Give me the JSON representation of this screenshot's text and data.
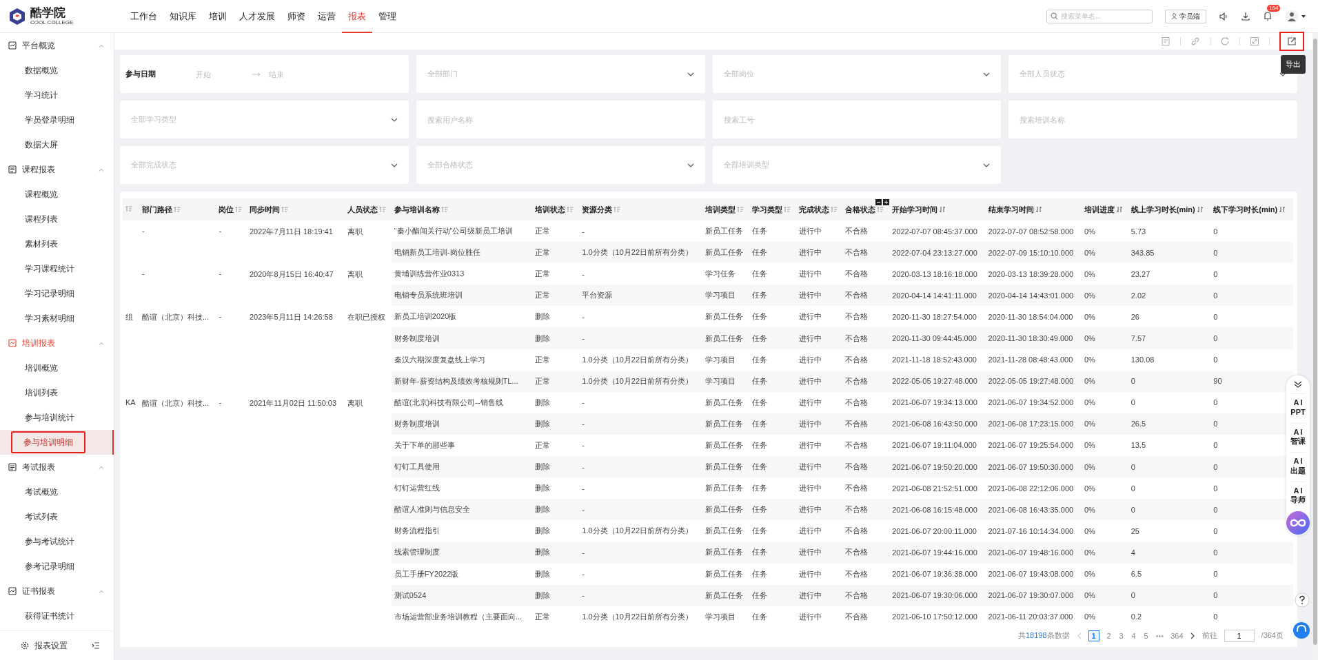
{
  "header": {
    "logo_name": "酷学院",
    "logo_sub": "COOL COLLEGE",
    "nav": [
      {
        "label": "工作台",
        "selected": false
      },
      {
        "label": "知识库",
        "selected": false
      },
      {
        "label": "培训",
        "selected": false
      },
      {
        "label": "人才发展",
        "selected": false
      },
      {
        "label": "师资",
        "selected": false
      },
      {
        "label": "运营",
        "selected": false
      },
      {
        "label": "报表",
        "selected": true
      },
      {
        "label": "管理",
        "selected": false
      }
    ],
    "search": {
      "placeholder": "搜索菜单名..."
    },
    "student_button": "学员端",
    "notification_count": "164"
  },
  "sidebar": {
    "groups": [
      {
        "title": "平台概览",
        "selected": false,
        "expanded": true,
        "items": [
          {
            "label": "数据概览",
            "selected": false
          },
          {
            "label": "学习统计",
            "selected": false
          },
          {
            "label": "学员登录明细",
            "selected": false
          },
          {
            "label": "数据大屏",
            "selected": false
          }
        ]
      },
      {
        "title": "课程报表",
        "selected": false,
        "expanded": true,
        "items": [
          {
            "label": "课程概览",
            "selected": false
          },
          {
            "label": "课程列表",
            "selected": false
          },
          {
            "label": "素材列表",
            "selected": false
          },
          {
            "label": "学习课程统计",
            "selected": false
          },
          {
            "label": "学习记录明细",
            "selected": false
          },
          {
            "label": "学习素材明细",
            "selected": false
          }
        ]
      },
      {
        "title": "培训报表",
        "selected": true,
        "expanded": true,
        "items": [
          {
            "label": "培训概览",
            "selected": false
          },
          {
            "label": "培训列表",
            "selected": false
          },
          {
            "label": "参与培训统计",
            "selected": false
          },
          {
            "label": "参与培训明细",
            "selected": true
          }
        ]
      },
      {
        "title": "考试报表",
        "selected": false,
        "expanded": true,
        "items": [
          {
            "label": "考试概览",
            "selected": false
          },
          {
            "label": "考试列表",
            "selected": false
          },
          {
            "label": "参与考试统计",
            "selected": false
          },
          {
            "label": "参考记录明细",
            "selected": false
          }
        ]
      },
      {
        "title": "证书报表",
        "selected": false,
        "expanded": true,
        "items": [
          {
            "label": "获得证书统计",
            "selected": false
          }
        ]
      }
    ],
    "settings": "报表设置"
  },
  "toolbar": {
    "export_tooltip": "导出"
  },
  "filters": [
    {
      "kind": "daterange",
      "label": "参与日期",
      "start_placeholder": "开始",
      "end_placeholder": "结束"
    },
    {
      "kind": "select",
      "placeholder": "全部部门"
    },
    {
      "kind": "select",
      "placeholder": "全部岗位"
    },
    {
      "kind": "select",
      "placeholder": "全部人员状态"
    },
    {
      "kind": "select",
      "placeholder": "全部学习类型"
    },
    {
      "kind": "input",
      "placeholder": "搜索用户名称"
    },
    {
      "kind": "input",
      "placeholder": "搜索工号"
    },
    {
      "kind": "input",
      "placeholder": "搜索培训名称"
    },
    {
      "kind": "select",
      "placeholder": "全部完成状态"
    },
    {
      "kind": "select",
      "placeholder": "全部合格状态"
    },
    {
      "kind": "select",
      "placeholder": "全部培训类型"
    }
  ],
  "table": {
    "columns": [
      {
        "kind": "list"
      },
      {
        "label": "部门路径",
        "kind": "list"
      },
      {
        "label": "岗位",
        "kind": "list"
      },
      {
        "label": "同步时间",
        "kind": "list"
      },
      {
        "label": "人员状态",
        "kind": "list"
      },
      {
        "label": "参与培训名称",
        "kind": "list"
      },
      {
        "label": "培训状态",
        "kind": "list"
      },
      {
        "label": "资源分类",
        "kind": "list"
      },
      {
        "label": "培训类型",
        "kind": "list"
      },
      {
        "label": "学习类型",
        "kind": "list"
      },
      {
        "label": "完成状态",
        "kind": "list"
      },
      {
        "label": "合格状态",
        "kind": "list",
        "expand_controls": true
      },
      {
        "label": "开始学习时间",
        "kind": "updown"
      },
      {
        "label": "结束学习时间",
        "kind": "updown"
      },
      {
        "label": "培训进度",
        "kind": "updown"
      },
      {
        "label": "线上学习时长(min)",
        "kind": "updown"
      },
      {
        "label": "线下学习时长(min)",
        "kind": "updown"
      }
    ],
    "groups": [
      {
        "department": "-",
        "post": "-",
        "sync_time": "2022年7月11日 18:19:41",
        "person_status": "离职",
        "trainings": [
          {
            "name": "“秦小酯闯关行动”公司级新员工培训",
            "status": "正常",
            "resource": "-",
            "type": "新员工任务",
            "learn_type": "任务",
            "completion": "进行中",
            "pass": "不合格",
            "start": "2022-07-07 08:45:37.000",
            "end": "2022-07-07 08:52:58.000",
            "progress": "0%",
            "online": "5.73",
            "offline": "0"
          },
          {
            "name": "电销新员工培训-岗位胜任",
            "status": "正常",
            "resource": "1.0分类（10月22日前所有分类）",
            "type": "新员工任务",
            "learn_type": "任务",
            "completion": "进行中",
            "pass": "不合格",
            "start": "2022-07-04 23:13:27.000",
            "end": "2022-07-09 15:10:10.000",
            "progress": "0%",
            "online": "343.85",
            "offline": "0"
          }
        ]
      },
      {
        "department": "-",
        "post": "-",
        "sync_time": "2020年8月15日 16:40:47",
        "person_status": "离职",
        "trainings": [
          {
            "name": "黄埔训练营作业0313",
            "status": "正常",
            "resource": "-",
            "type": "学习任务",
            "learn_type": "任务",
            "completion": "进行中",
            "pass": "不合格",
            "start": "2020-03-13 18:16:18.000",
            "end": "2020-03-13 18:39:28.000",
            "progress": "0%",
            "online": "23.27",
            "offline": "0"
          },
          {
            "name": "电销专员系统班培训",
            "status": "正常",
            "resource": "平台资源",
            "type": "学习项目",
            "learn_type": "任务",
            "completion": "进行中",
            "pass": "不合格",
            "start": "2020-04-14 14:41:11.000",
            "end": "2020-04-14 14:43:01.000",
            "progress": "0%",
            "online": "2.02",
            "offline": "0"
          }
        ]
      },
      {
        "column_1": "组",
        "department": "酷谊（北京）科技...",
        "post": "-",
        "sync_time": "2023年5月11日 14:26:58",
        "person_status": "在职已授权",
        "trainings": [
          {
            "name": "新员工培训2020版",
            "status": "删除",
            "resource": "-",
            "type": "新员工任务",
            "learn_type": "任务",
            "completion": "进行中",
            "pass": "不合格",
            "start": "2020-11-30 18:27:54.000",
            "end": "2020-11-30 18:54:04.000",
            "progress": "0%",
            "online": "26",
            "offline": "0"
          },
          {
            "name": "财务制度培训",
            "status": "删除",
            "resource": "-",
            "type": "新员工任务",
            "learn_type": "任务",
            "completion": "进行中",
            "pass": "不合格",
            "start": "2020-11-30 09:44:45.000",
            "end": "2020-11-30 18:30:49.000",
            "progress": "0%",
            "online": "7.57",
            "offline": "0"
          },
          {
            "name": "秦汉六期深度复盘线上学习",
            "status": "正常",
            "resource": "1.0分类（10月22日前所有分类）",
            "type": "学习项目",
            "learn_type": "任务",
            "completion": "进行中",
            "pass": "不合格",
            "start": "2021-11-18 18:52:43.000",
            "end": "2021-11-28 08:48:43.000",
            "progress": "0%",
            "online": "130.08",
            "offline": "0"
          },
          {
            "name": "新财年-薪资结构及绩效考核规则TL...",
            "status": "正常",
            "resource": "1.0分类（10月22日前所有分类）",
            "type": "学习项目",
            "learn_type": "任务",
            "completion": "进行中",
            "pass": "不合格",
            "start": "2022-05-05 19:27:48.000",
            "end": "2022-05-05 19:27:48.000",
            "progress": "0%",
            "online": "0",
            "offline": "90"
          }
        ]
      },
      {
        "column_1": "KA",
        "department": "酷谊（北京）科技...",
        "post": "-",
        "sync_time": "2021年11月02日 11:50:03",
        "person_status": "离职",
        "trainings": [
          {
            "name": "酷谊(北京)科技有限公司--销售线",
            "status": "删除",
            "resource": "-",
            "type": "新员工任务",
            "learn_type": "任务",
            "completion": "进行中",
            "pass": "不合格",
            "start": "2021-06-07 19:34:13.000",
            "end": "2021-06-07 19:34:52.000",
            "progress": "0%",
            "online": "0",
            "offline": "0"
          },
          {
            "name": "财务制度培训",
            "status": "删除",
            "resource": "-",
            "type": "新员工任务",
            "learn_type": "任务",
            "completion": "进行中",
            "pass": "不合格",
            "start": "2021-06-08 16:43:50.000",
            "end": "2021-06-08 17:23:15.000",
            "progress": "0%",
            "online": "26.5",
            "offline": "0"
          },
          {
            "name": "关于下单的那些事",
            "status": "正常",
            "resource": "-",
            "type": "新员工任务",
            "learn_type": "任务",
            "completion": "进行中",
            "pass": "不合格",
            "start": "2021-06-07 19:11:04.000",
            "end": "2021-06-07 19:25:54.000",
            "progress": "0%",
            "online": "13.5",
            "offline": "0"
          },
          {
            "name": "钉钉工具使用",
            "status": "删除",
            "resource": "-",
            "type": "新员工任务",
            "learn_type": "任务",
            "completion": "进行中",
            "pass": "不合格",
            "start": "2021-06-07 19:50:20.000",
            "end": "2021-06-07 19:50:30.000",
            "progress": "0%",
            "online": "0",
            "offline": "0"
          },
          {
            "name": "钉钉运营红线",
            "status": "删除",
            "resource": "-",
            "type": "新员工任务",
            "learn_type": "任务",
            "completion": "进行中",
            "pass": "不合格",
            "start": "2021-06-08 21:52:51.000",
            "end": "2021-06-08 22:12:06.000",
            "progress": "0%",
            "online": "0",
            "offline": "0"
          },
          {
            "name": "酷谊人准则与信息安全",
            "status": "删除",
            "resource": "-",
            "type": "新员工任务",
            "learn_type": "任务",
            "completion": "进行中",
            "pass": "不合格",
            "start": "2021-06-08 16:15:48.000",
            "end": "2021-06-08 16:43:35.000",
            "progress": "0%",
            "online": "0",
            "offline": "0"
          },
          {
            "name": "财务流程指引",
            "status": "删除",
            "resource": "1.0分类（10月22日前所有分类）",
            "type": "新员工任务",
            "learn_type": "任务",
            "completion": "进行中",
            "pass": "不合格",
            "start": "2021-06-07 20:00:11.000",
            "end": "2021-07-16 10:14:34.000",
            "progress": "0%",
            "online": "25",
            "offline": "0"
          },
          {
            "name": "线索管理制度",
            "status": "删除",
            "resource": "-",
            "type": "新员工任务",
            "learn_type": "任务",
            "completion": "进行中",
            "pass": "不合格",
            "start": "2021-06-07 19:44:16.000",
            "end": "2021-06-07 19:48:16.000",
            "progress": "0%",
            "online": "4",
            "offline": "0"
          },
          {
            "name": "员工手册FY2022版",
            "status": "删除",
            "resource": "-",
            "type": "新员工任务",
            "learn_type": "任务",
            "completion": "进行中",
            "pass": "不合格",
            "start": "2021-06-07 19:36:38.000",
            "end": "2021-06-07 19:43:08.000",
            "progress": "0%",
            "online": "6.5",
            "offline": "0"
          },
          {
            "name": "测试0524",
            "status": "删除",
            "resource": "-",
            "type": "新员工任务",
            "learn_type": "任务",
            "completion": "进行中",
            "pass": "不合格",
            "start": "2021-06-07 19:30:06.000",
            "end": "2021-06-07 19:30:07.000",
            "progress": "0%",
            "online": "0",
            "offline": "0"
          },
          {
            "name": "市场运营部业务培训教程（主要面向...",
            "status": "正常",
            "resource": "1.0分类（10月22日前所有分类）",
            "type": "学习项目",
            "learn_type": "任务",
            "completion": "进行中",
            "pass": "不合格",
            "start": "2021-06-10 17:50:12.000",
            "end": "2021-06-11 20:03:37.000",
            "progress": "0%",
            "online": "0.2",
            "offline": "0"
          }
        ]
      }
    ]
  },
  "pagination": {
    "total_prefix": "共",
    "total": "18198",
    "total_suffix": "条数据",
    "pages": [
      {
        "label": "1",
        "kind": "page",
        "selected": true
      },
      {
        "label": "2",
        "kind": "page",
        "selected": false
      },
      {
        "label": "3",
        "kind": "page",
        "selected": false
      },
      {
        "label": "4",
        "kind": "page",
        "selected": false
      },
      {
        "label": "5",
        "kind": "page",
        "selected": false
      },
      {
        "label": "•••",
        "kind": "ellipsis",
        "selected": false
      },
      {
        "label": "364",
        "kind": "page",
        "selected": false
      }
    ],
    "goto_label": "前往",
    "goto_value": "1",
    "page_count": "/364页"
  },
  "ai_panel": [
    {
      "top": "AI",
      "bottom": "PPT"
    },
    {
      "top": "AI",
      "bottom": "智课"
    },
    {
      "top": "AI",
      "bottom": "出题"
    },
    {
      "top": "AI",
      "bottom": "导师"
    }
  ]
}
